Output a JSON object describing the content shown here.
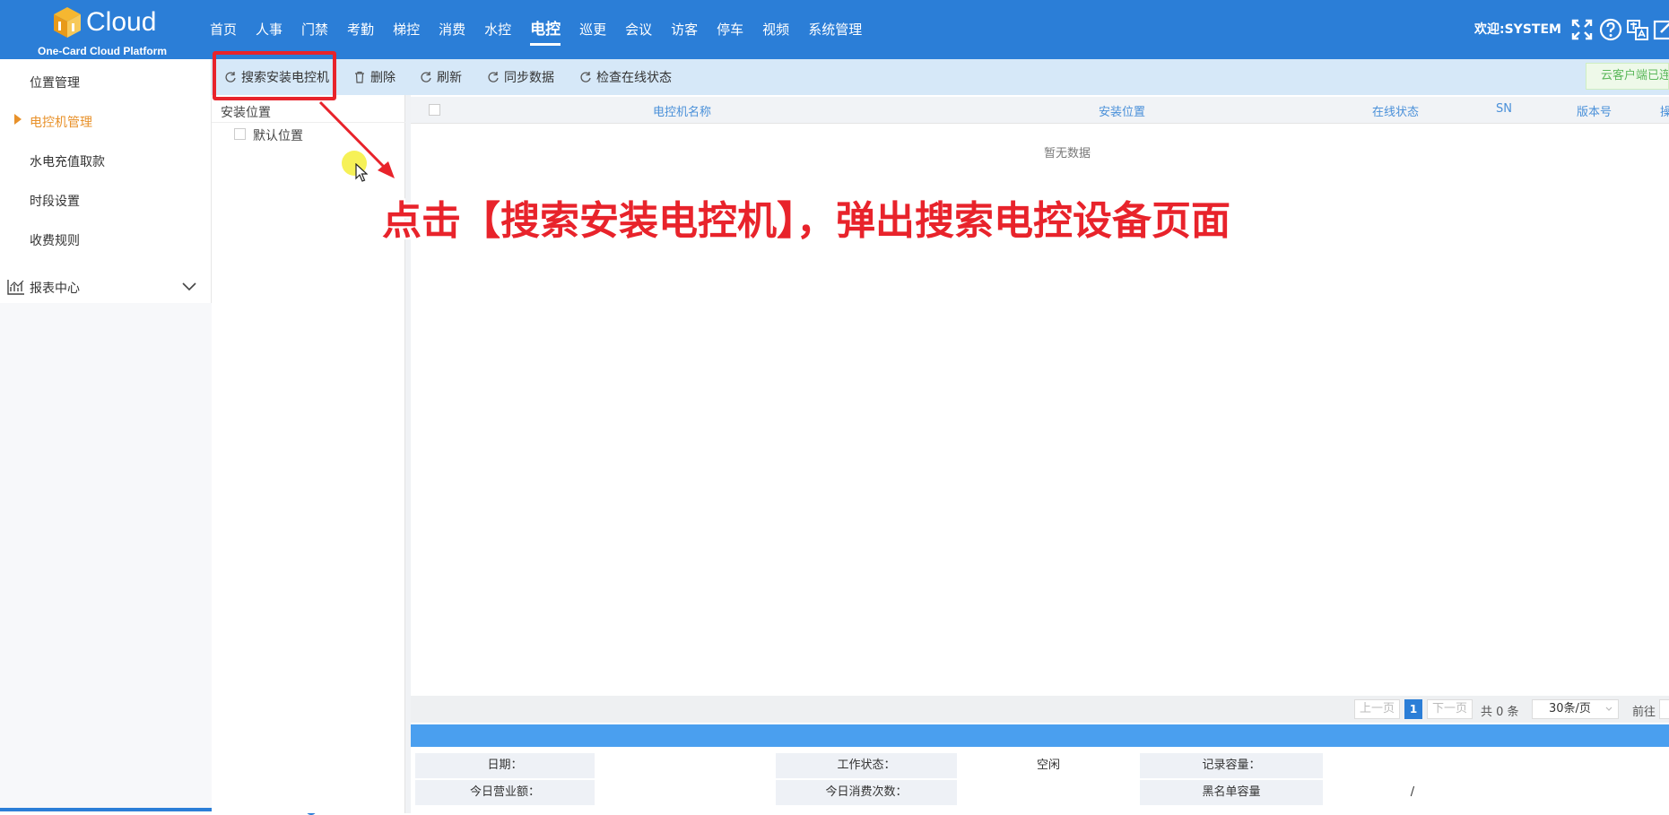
{
  "app": {
    "brand": "Cloud",
    "subtitle": "One-Card Cloud Platform",
    "welcome": "欢迎:SYSTEM"
  },
  "nav": {
    "items": [
      {
        "label": "首页"
      },
      {
        "label": "人事"
      },
      {
        "label": "门禁"
      },
      {
        "label": "考勤"
      },
      {
        "label": "梯控"
      },
      {
        "label": "消费"
      },
      {
        "label": "水控"
      },
      {
        "label": "电控",
        "active": true
      },
      {
        "label": "巡更"
      },
      {
        "label": "会议"
      },
      {
        "label": "访客"
      },
      {
        "label": "停车"
      },
      {
        "label": "视频"
      },
      {
        "label": "系统管理"
      }
    ]
  },
  "top_icons": [
    "fullscreen-icon",
    "help-icon",
    "language-icon",
    "edit-icon"
  ],
  "sidebar": {
    "items": [
      {
        "label": "位置管理"
      },
      {
        "label": "电控机管理",
        "active": true
      },
      {
        "label": "水电充值取款"
      },
      {
        "label": "时段设置"
      },
      {
        "label": "收费规则"
      }
    ],
    "report": "报表中心"
  },
  "toolbar": {
    "search_install": "搜索安装电控机",
    "delete": "删除",
    "refresh": "刷新",
    "sync": "同步数据",
    "check_online": "检查在线状态",
    "cloud_status": "云客户端已连"
  },
  "tree": {
    "header": "安装位置",
    "nodes": [
      "默认位置"
    ]
  },
  "table": {
    "columns": [
      "电控机名称",
      "安装位置",
      "在线状态",
      "SN",
      "版本号",
      "操"
    ],
    "empty_text": "暂无数据"
  },
  "pager": {
    "prev": "上一页",
    "current": "1",
    "next": "下一页",
    "total": "共 0 条",
    "page_size": "30条/页",
    "goto": "前往"
  },
  "info": {
    "date_label": "日期：",
    "date_value": "",
    "work_status_label": "工作状态：",
    "work_status_value": "空闲",
    "record_capacity_label": "记录容量：",
    "record_capacity_value": "",
    "today_revenue_label": "今日营业额：",
    "today_revenue_value": "",
    "today_count_label": "今日消费次数：",
    "today_count_value": "",
    "blacklist_label": "黑名单容量",
    "blacklist_value": "/"
  },
  "annotation": {
    "caption": "点击【搜索安装电控机】，弹出搜索电控设备页面"
  },
  "colors": {
    "topbar": "#2b7ed7",
    "accent_orange": "#e8912a",
    "annotation_red": "#e8232b",
    "toolbar_bg": "#d6e8f8"
  }
}
